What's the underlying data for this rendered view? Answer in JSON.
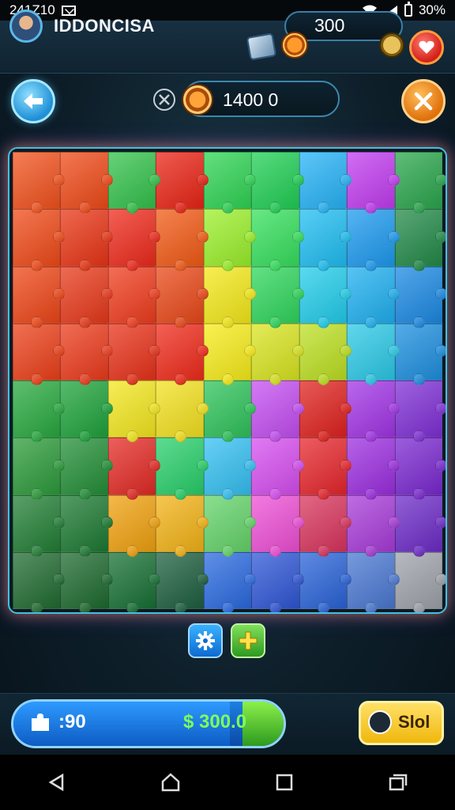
{
  "status_bar": {
    "time": "241Z10",
    "battery_text": "30%"
  },
  "header": {
    "player_name": "IDDONCISA",
    "currency": "300"
  },
  "score_bar": {
    "value": "1400 0"
  },
  "board": {
    "rows": [
      [
        "#f2521d",
        "#f04a18",
        "#34c24b",
        "#ea2416",
        "#2fd454",
        "#21cf55",
        "#26b3f6",
        "#c23cf0",
        "#2aa64c"
      ],
      [
        "#f04a18",
        "#e93515",
        "#ef2a1c",
        "#f25a15",
        "#9bf02b",
        "#36e05d",
        "#1fbef2",
        "#1d9aef",
        "#228a48"
      ],
      [
        "#ee4617",
        "#e8391a",
        "#f03c1d",
        "#e94818",
        "#f4e919",
        "#2fd65c",
        "#22cdeb",
        "#1fb0f0",
        "#1b89e3"
      ],
      [
        "#ec4019",
        "#ec3b1c",
        "#e83219",
        "#f02b1b",
        "#f7ec1a",
        "#d9e520",
        "#bde022",
        "#2bc9e7",
        "#1d8fdf"
      ],
      [
        "#28a93f",
        "#1ea33b",
        "#f3e71e",
        "#f3e11f",
        "#2ec35a",
        "#c44ef2",
        "#e0221e",
        "#a234e6",
        "#7f2fd6"
      ],
      [
        "#2c9b3a",
        "#238f37",
        "#e42a24",
        "#28cf6a",
        "#34c0f2",
        "#d64ef0",
        "#e6262c",
        "#9c2ee0",
        "#7a28d0"
      ],
      [
        "#227f35",
        "#1c7a32",
        "#f0a10e",
        "#f3b316",
        "#64d46a",
        "#ee4fd6",
        "#d9345d",
        "#a83bd9",
        "#6d2bc8"
      ],
      [
        "#206b31",
        "#1d6a2f",
        "#177034",
        "#1d5f3f",
        "#2a6ae0",
        "#2f56d6",
        "#2963d8",
        "#4a78d2",
        "#9ea2aa"
      ]
    ]
  },
  "tools": {
    "gear_label": "",
    "plus_label": ""
  },
  "bottom": {
    "pieces": ":90",
    "money": "$ 300.0",
    "progress_fraction": 0.8,
    "play_label": "Slol"
  },
  "colors": {
    "accent_blue": "#3fc0e8",
    "accent_orange": "#ffa43a",
    "accent_green": "#7dff5a"
  }
}
